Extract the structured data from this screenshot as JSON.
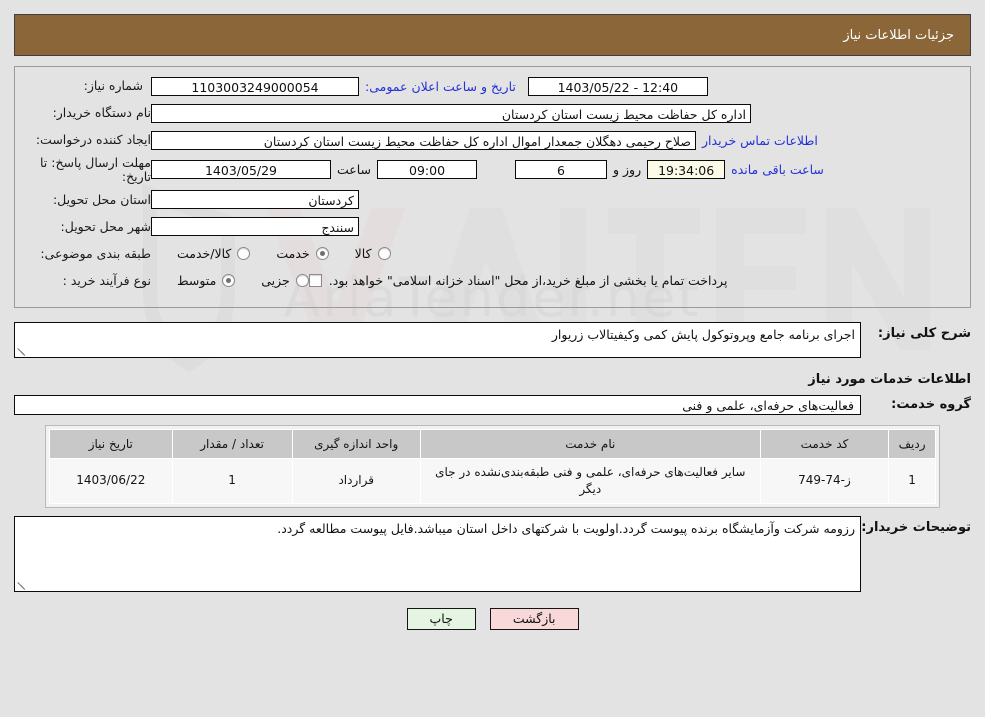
{
  "header": {
    "title": "جزئیات اطلاعات نیاز"
  },
  "public_announce": {
    "label": "تاریخ و ساعت اعلان عمومی:",
    "value": "12:40 - 1403/05/22"
  },
  "fields": {
    "need_number_label": "شماره نیاز:",
    "need_number_value": "1103003249000054",
    "buyer_org_label": "نام دستگاه خریدار:",
    "buyer_org_value": "اداره کل حفاظت محیط زیست استان کردستان",
    "creator_label": "ایجاد کننده درخواست:",
    "creator_value": "صلاح  رحیمی دهگلان جمعدار اموال اداره کل حفاظت محیط زیست استان کردستان",
    "contact_link": "اطلاعات تماس خریدار",
    "deadline_label": "مهلت ارسال پاسخ: تا تاریخ:",
    "deadline_date": "1403/05/29",
    "time_label": "ساعت",
    "deadline_time": "09:00",
    "days_value": "6",
    "days_label": "روز و",
    "countdown_value": "19:34:06",
    "remaining_label": "ساعت باقی مانده",
    "province_label": "استان محل تحویل:",
    "province_value": "کردستان",
    "city_label": "شهر محل تحویل:",
    "city_value": "سنندج",
    "category_label": "طبقه بندی موضوعی:",
    "category_options": [
      {
        "label": "کالا",
        "selected": false
      },
      {
        "label": "خدمت",
        "selected": true
      },
      {
        "label": "کالا/خدمت",
        "selected": false
      }
    ],
    "process_label": "نوع فرآیند خرید :",
    "process_options": [
      {
        "label": "جزیی",
        "selected": false
      },
      {
        "label": "متوسط",
        "selected": true
      }
    ],
    "treasury_checkbox_text": "پرداخت تمام یا بخشی از مبلغ خرید،از محل \"اسناد خزانه اسلامی\" خواهد بود.",
    "treasury_checked": false
  },
  "description": {
    "label": "شرح کلی نیاز:",
    "value": "اجرای برنامه جامع وپروتوکول پایش کمی وکیفیتالاب زریوار"
  },
  "services_section": {
    "heading": "اطلاعات خدمات مورد نیاز",
    "group_label": "گروه خدمت:",
    "group_value": "فعالیت‌های حرفه‌ای، علمی و فنی"
  },
  "table": {
    "columns": [
      "ردیف",
      "کد خدمت",
      "نام خدمت",
      "واحد اندازه گیری",
      "تعداد / مقدار",
      "تاریخ نیاز"
    ],
    "rows": [
      {
        "index": "1",
        "code": "ز-74-749",
        "name": "سایر فعالیت‌های حرفه‌ای، علمی و فنی طبقه‌بندی‌نشده در جای دیگر",
        "unit": "قرارداد",
        "qty": "1",
        "date": "1403/06/22"
      }
    ]
  },
  "buyer_notes": {
    "label": "توضیحات خریدار:",
    "value": "رزومه شرکت وآزمایشگاه برنده پیوست گردد.اولویت با شرکتهای داخل استان میباشد.فایل پیوست مطالعه گردد."
  },
  "footer": {
    "print_label": "چاپ",
    "back_label": "بازگشت"
  },
  "watermark": {
    "text": "AriaTender.net"
  },
  "colors": {
    "header_bar": "#8b6639",
    "page_bg": "#e3e3e3",
    "link": "#2331d8",
    "print_btn": "#e4f5e2",
    "back_btn": "#f8d8d8",
    "countdown_bg": "#fbfbe8"
  }
}
